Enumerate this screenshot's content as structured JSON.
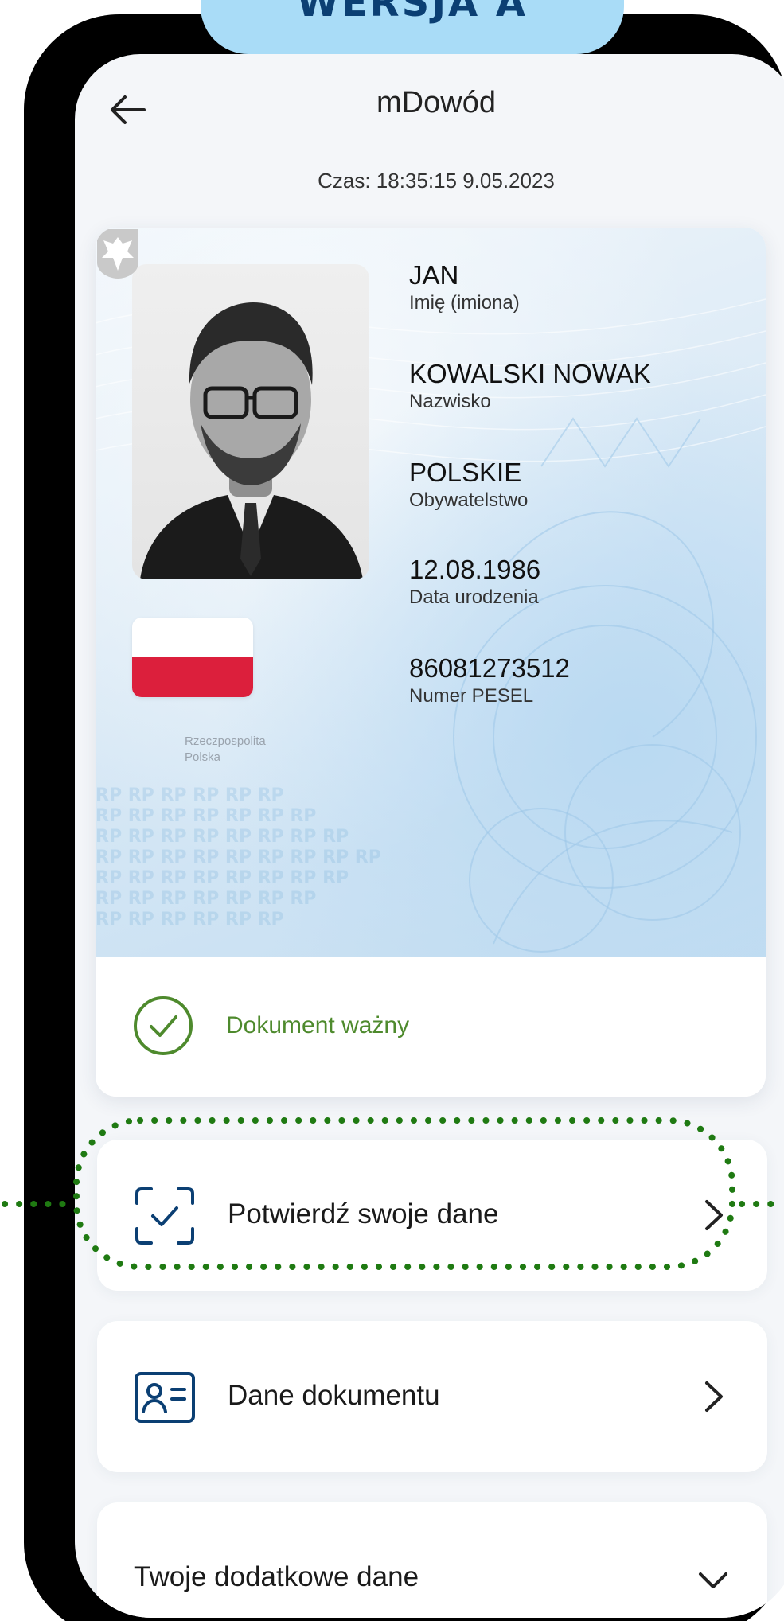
{
  "version_tab": {
    "label": "WERSJA A"
  },
  "header": {
    "title": "mDowód",
    "back_icon": "arrow-left-icon"
  },
  "time": {
    "text": "Czas: 18:35:15 9.05.2023"
  },
  "id_card": {
    "fields": [
      {
        "value": "JAN",
        "label": "Imię (imiona)"
      },
      {
        "value": "KOWALSKI NOWAK",
        "label": "Nazwisko"
      },
      {
        "value": "POLSKIE",
        "label": "Obywatelstwo"
      },
      {
        "value": "12.08.1986",
        "label": "Data urodzenia"
      },
      {
        "value": "86081273512",
        "label": "Numer PESEL"
      }
    ],
    "emblem_text": [
      "Rzeczpospolita",
      "Polska"
    ],
    "watermark": "RP",
    "status": {
      "text": "Dokument ważny",
      "icon": "check-circle-icon",
      "color": "#4e8a2d"
    },
    "flag_colors": {
      "white": "#ffffff",
      "red": "#dc1f3c"
    }
  },
  "tiles": [
    {
      "label": "Potwierdź swoje dane",
      "icon": "scan-check-icon",
      "chevron": "chevron-right-icon"
    },
    {
      "label": "Dane dokumentu",
      "icon": "id-card-icon",
      "chevron": "chevron-right-icon"
    },
    {
      "label": "Twoje dodatkowe dane",
      "chevron": "chevron-down-icon"
    }
  ],
  "colors": {
    "accent_blue": "#0b3f73",
    "tab_bg": "#a9dcf7",
    "highlight_green": "#1f7a12",
    "screen_bg": "#f4f6f9"
  }
}
